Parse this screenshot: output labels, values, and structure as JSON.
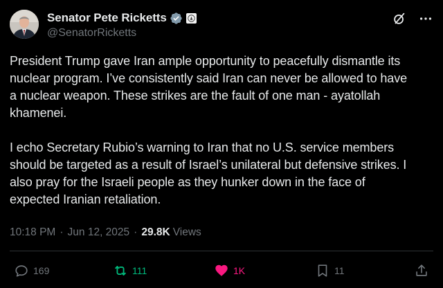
{
  "author": {
    "display_name": "Senator Pete Ricketts",
    "handle": "@SenatorRicketts"
  },
  "tweet": {
    "text": "President Trump gave Iran ample opportunity to peacefully dismantle its\nnuclear program. I’ve consistently said Iran can never be allowed to have\na nuclear weapon. These strikes are the fault of one man - ayatollah\nkhamenei.\n\nI echo Secretary Rubio’s warning to Iran that no U.S. service members\nshould be targeted as a result of Israel’s unilateral but defensive strikes. I\nalso pray for the Israeli people as they hunker down in the face of\nexpected Iranian retaliation."
  },
  "meta": {
    "time": "10:18 PM",
    "separator": "·",
    "date": "Jun 12, 2025",
    "views_count": "29.8K",
    "views_label": "Views"
  },
  "actions": {
    "replies": "169",
    "reposts": "111",
    "likes": "1K",
    "bookmarks": "11"
  },
  "icons": {
    "verified": "verified-badge-icon",
    "affiliation": "senate-seal-icon",
    "grok": "grok-icon",
    "more": "more-icon",
    "reply": "reply-icon",
    "repost": "repost-icon",
    "like": "heart-icon",
    "bookmark": "bookmark-icon",
    "share": "share-icon"
  },
  "colors": {
    "background": "#000000",
    "text": "#e7e9ea",
    "muted": "#71767b",
    "verified": "#829aab",
    "repost_active": "#00ba7c",
    "like_active": "#f91880"
  }
}
